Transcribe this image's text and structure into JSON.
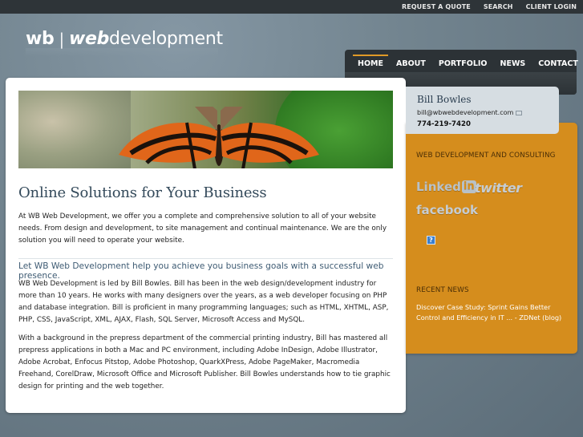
{
  "topbar": {
    "links": [
      "REQUEST A QUOTE",
      "SEARCH",
      "CLIENT LOGIN"
    ]
  },
  "logo": {
    "wb": "wb",
    "separator": "|",
    "web": "web",
    "development": "development"
  },
  "nav": {
    "items": [
      "HOME",
      "ABOUT",
      "PORTFOLIO",
      "NEWS",
      "CONTACT"
    ],
    "active": "HOME",
    "accent_color": "#e09a27"
  },
  "main": {
    "title": "Online Solutions for Your Business",
    "intro": "At WB Web Development, we offer you a complete and comprehensive solution to all of your website needs. From design and development, to site management and continual maintenance. We are the only solution you will need to operate your website.",
    "tagline": "Let WB Web Development help you achieve you business goals with a successful web presence.",
    "para2": "WB Web Development is led by Bill Bowles. Bill has been in the web design/development industry for more than 10 years. He works with many designers over the years, as a web developer focusing on PHP and database integration. Bill is proficient in many programming languages; such as HTML, XHTML, ASP, PHP, CSS, JavaScript, XML, AJAX, Flash, SQL Server, Microsoft Access and MySQL.",
    "para3": "With a background in the prepress department of the commercial printing industry, Bill has mastered all prepress applications in both a Mac and PC environment, including Adobe InDesign, Adobe Illustrator, Adobe Acrobat, Enfocus Pitstop, Adobe Photoshop, QuarkXPress, Adobe PageMaker, Macromedia Freehand, CorelDraw, Microsoft Office and Microsoft Publisher. Bill Bowles understands how to tie graphic design for printing and the web together."
  },
  "contact": {
    "name": "Bill Bowles",
    "email": "bill@wbwebdevelopment.com",
    "phone": "774-219-7420"
  },
  "sidebar": {
    "heading": "WEB DEVELOPMENT AND CONSULTING",
    "social": {
      "linkedin_text": "Linked",
      "linkedin_box": "in",
      "twitter": "twitter",
      "facebook": "facebook"
    },
    "help_icon": "?",
    "news_heading": "RECENT NEWS",
    "news_item": "Discover Case Study: Sprint Gains Better Control and Efficiency in IT ... - ZDNet (blog)",
    "color": "#d58d1d"
  }
}
